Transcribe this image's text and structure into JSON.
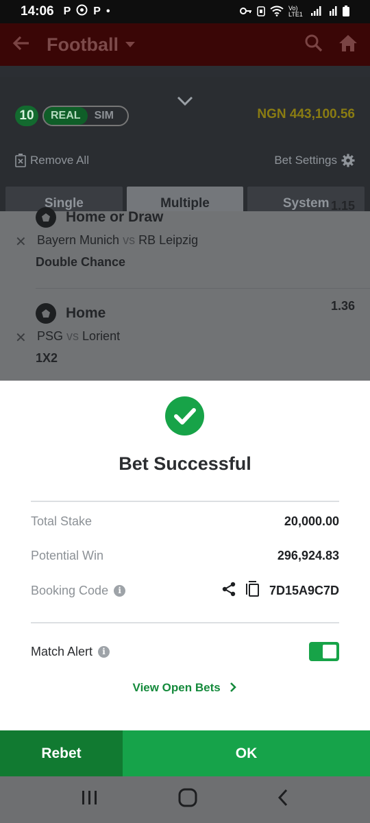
{
  "status_bar": {
    "time": "14:06",
    "left_icons": [
      "P",
      "P"
    ],
    "network_label": "Vo) LTE1"
  },
  "app_bar": {
    "title": "Football"
  },
  "betslip": {
    "count": "10",
    "mode_real": "REAL",
    "mode_sim": "SIM",
    "balance": "NGN 443,100.56",
    "remove_all": "Remove All",
    "bet_settings": "Bet Settings",
    "tabs": [
      "Single",
      "Multiple",
      "System"
    ],
    "active_tab": "Multiple",
    "items": [
      {
        "pick": "Home or Draw",
        "home": "Bayern Munich",
        "vs": "vs",
        "away": "RB Leipzig",
        "market": "Double Chance",
        "odds": "1.15"
      },
      {
        "pick": "Home",
        "home": "PSG",
        "vs": "vs",
        "away": "Lorient",
        "market": "1X2",
        "odds": "1.36"
      }
    ]
  },
  "sheet": {
    "title": "Bet Successful",
    "total_stake_label": "Total Stake",
    "total_stake": "20,000.00",
    "potential_win_label": "Potential Win",
    "potential_win": "296,924.83",
    "booking_code_label": "Booking Code",
    "booking_code": "7D15A9C7D",
    "match_alert_label": "Match Alert",
    "match_alert_on": true,
    "view_open_bets": "View Open Bets",
    "info_glyph": "i"
  },
  "buttons": {
    "rebet": "Rebet",
    "ok": "OK"
  },
  "colors": {
    "accent_green": "#16a34a",
    "dark_green": "#117a31",
    "link_green": "#158a3c"
  }
}
